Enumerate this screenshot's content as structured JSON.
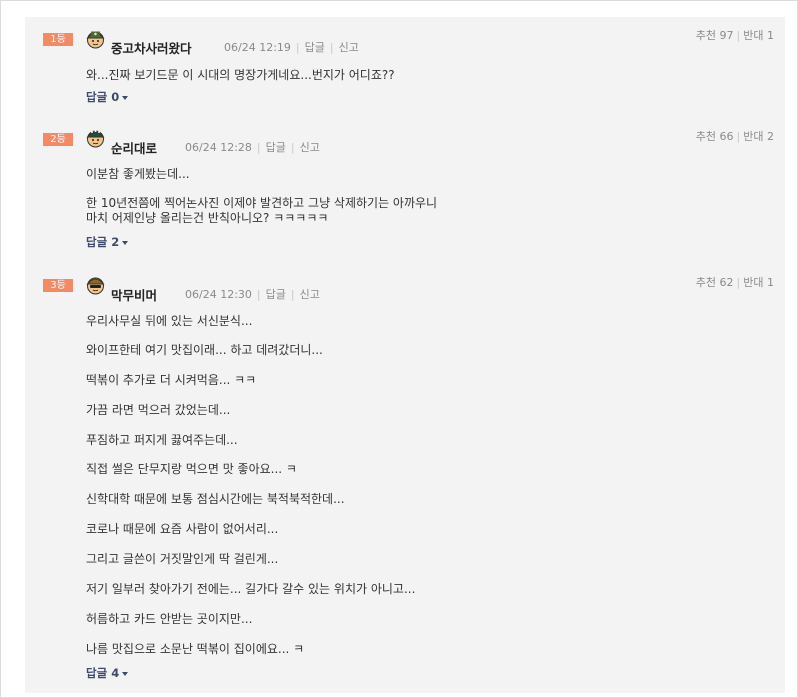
{
  "comments": [
    {
      "rank": "1등",
      "author": "중고차사러왔다",
      "time": "06/24 12:19",
      "reply_label": "답글",
      "report_label": "신고",
      "votes": {
        "up_label": "추천",
        "up": "97",
        "down_label": "반대",
        "down": "1"
      },
      "lines": [
        "와...진짜 보기드문 이 시대의 명장가게네요...번지가 어디죠??"
      ],
      "reply_toggle": {
        "label": "답글",
        "count": "0"
      }
    },
    {
      "rank": "2등",
      "author": "순리대로",
      "time": "06/24 12:28",
      "reply_label": "답글",
      "report_label": "신고",
      "votes": {
        "up_label": "추천",
        "up": "66",
        "down_label": "반대",
        "down": "2"
      },
      "lines": [
        "이분참 좋게봤는데...",
        "한 10년전쯤에 찍어논사진 이제야 발견하고 그냥 삭제하기는 아까우니",
        "마치 어제인냥 올리는건 반칙아니오? ㅋㅋㅋㅋㅋ"
      ],
      "reply_toggle": {
        "label": "답글",
        "count": "2"
      }
    },
    {
      "rank": "3등",
      "author": "막무비머",
      "time": "06/24 12:30",
      "reply_label": "답글",
      "report_label": "신고",
      "votes": {
        "up_label": "추천",
        "up": "62",
        "down_label": "반대",
        "down": "1"
      },
      "lines": [
        "우리사무실 뒤에 있는 서신분식...",
        "와이프한테 여기 맛집이래... 하고 데려갔더니...",
        "떡볶이 추가로 더 시켜먹음... ㅋㅋ",
        "가끔 라면 먹으러 갔었는데...",
        "푸짐하고 퍼지게 끓여주는데...",
        "직접 썰은 단무지랑 먹으면 맛 좋아요... ㅋ",
        "신학대학 때문에 보통 점심시간에는 북적북적한데...",
        "코로나 때문에 요즘 사람이 없어서리...",
        "그리고 글쓴이 거짓말인게 딱 걸린게...",
        "저기 일부러 찾아가기 전에는... 길가다 갈수 있는 위치가 아니고...",
        "허름하고 카드 안받는 곳이지만...",
        "나름 맛집으로 소문난 떡볶이 집이에요... ㅋ"
      ],
      "reply_toggle": {
        "label": "답글",
        "count": "4"
      }
    }
  ]
}
